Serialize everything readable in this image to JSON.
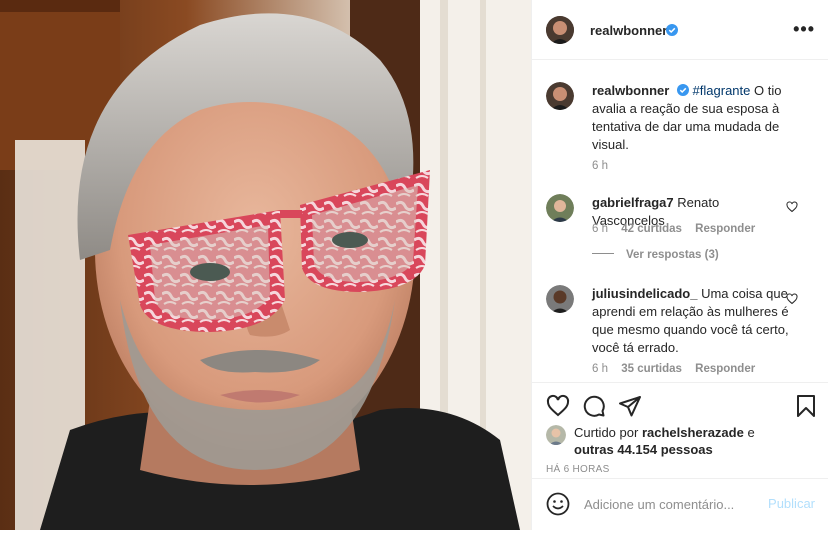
{
  "post": {
    "username": "realwbonner",
    "verified_color": "#3897f0",
    "caption": {
      "username": "realwbonner",
      "hashtag": "#flagrante",
      "text": "O tio avalia a reação de sua esposa à tentativa de dar uma mudada de visual.",
      "time": "6 h"
    },
    "comments": [
      {
        "username": "gabrielfraga7",
        "text": "Renato Vasconcelos",
        "time": "6 h",
        "likes": "42 curtidas",
        "reply": "Responder",
        "view_replies": "Ver respostas (3)"
      },
      {
        "username": "juliusindelicado_",
        "text": "Uma coisa que aprendi em relação às mulheres é que mesmo quando você tá certo, você tá errado.",
        "time": "6 h",
        "likes": "35 curtidas",
        "reply": "Responder"
      }
    ],
    "likes": {
      "prefix": "Curtido por",
      "user": "rachelsherazade",
      "conj": "e",
      "others": "outras 44.154 pessoas"
    },
    "timestamp": "HÁ 6 HORAS",
    "add_comment": {
      "placeholder": "Adicione um comentário...",
      "publish": "Publicar"
    },
    "colors": {
      "link": "#00376b",
      "muted": "#8e8e8e",
      "publish_disabled": "#b2dffc",
      "glasses": "#d9475b"
    },
    "icons": [
      "heart-icon",
      "comment-icon",
      "share-icon",
      "bookmark-icon",
      "emoji-icon",
      "more-icon",
      "verified-icon"
    ]
  }
}
